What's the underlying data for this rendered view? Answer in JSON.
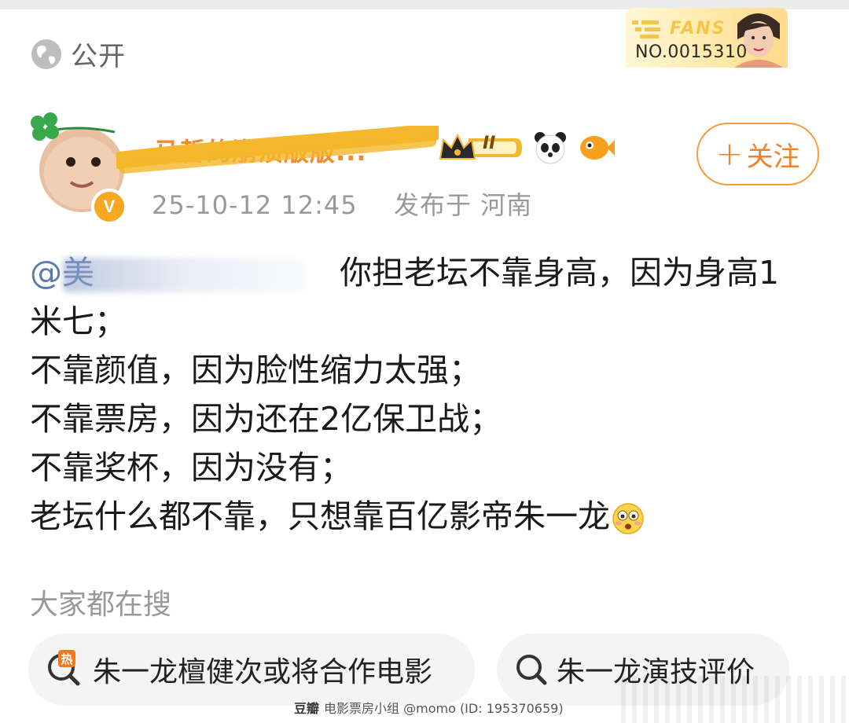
{
  "visibility": {
    "label": "公开",
    "icon": "globe-icon"
  },
  "fans_badge": {
    "title": "FANS",
    "number": "NO.0015310"
  },
  "author": {
    "name": "马哲的崩溃版版...",
    "verified_mark": "V",
    "level_badge": "II",
    "badges": [
      "crown-level-icon",
      "panda-icon",
      "fish-icon"
    ]
  },
  "meta": {
    "datetime": "25-10-12 12:45",
    "location": "发布于 河南"
  },
  "follow_button": {
    "plus": "+",
    "label": "关注"
  },
  "post": {
    "mention": "@美",
    "lines": [
      "你担老坛不靠身高，因为身高1",
      "米七；",
      "不靠颜值，因为脸性缩力太强；",
      "不靠票房，因为还在2亿保卫战；",
      "不靠奖杯，因为没有；",
      "老坛什么都不靠，只想靠百亿影帝朱一龙"
    ],
    "trailing_emoji": "flushed-face-icon"
  },
  "search": {
    "label": "大家都在搜",
    "chips": [
      {
        "icon": "hot-search-icon",
        "text": "朱一龙檀健次或将合作电影"
      },
      {
        "icon": "search-icon",
        "text": "朱一龙演技评价"
      }
    ]
  },
  "watermark": {
    "logo": "豆瓣",
    "text": "电影票房小组 @momo (ID: 195370659)"
  },
  "colors": {
    "accent": "#f0822a",
    "mention": "#5a7bb0",
    "muted": "#999999"
  }
}
